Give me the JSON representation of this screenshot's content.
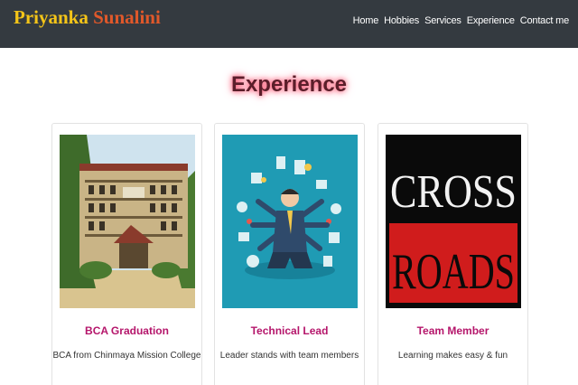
{
  "brand": {
    "first": "Priyanka",
    "last": "Sunalini"
  },
  "nav": [
    "Home",
    "Hobbies",
    "Services",
    "Experience",
    "Contact me"
  ],
  "section": {
    "title": "Experience"
  },
  "cards": [
    {
      "title": "BCA Graduation",
      "text": "BCA from Chinmaya Mission College",
      "image_icon": "college-building-photo"
    },
    {
      "title": "Technical Lead",
      "text": "Leader stands with team members",
      "image_icon": "multitasking-leader-illustration"
    },
    {
      "title": "Team Member",
      "text": "Learning makes easy & fun",
      "image_icon": "cross-roads-sign"
    }
  ],
  "cross_roads": {
    "line1": "CROSS",
    "line2": "ROADS"
  },
  "colors": {
    "navbar": "#343a40",
    "brand_first": "#f5c518",
    "brand_last": "#e0582a",
    "card_title": "#b5166b"
  }
}
